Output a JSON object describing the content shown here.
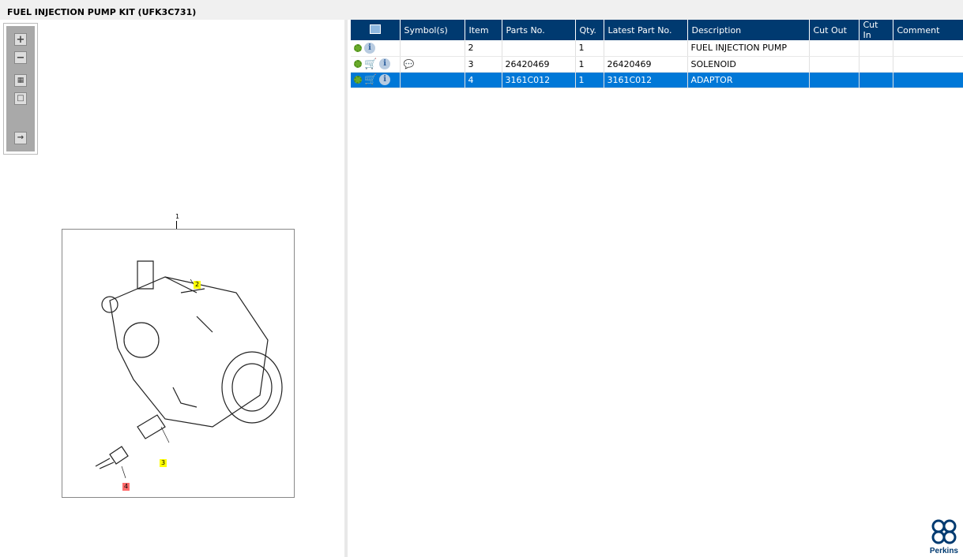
{
  "title": "FUEL INJECTION PUMP KIT (UFK3C731)",
  "toolbox": {
    "zoom_in": "zoom-in",
    "zoom_out": "zoom-out",
    "fit_all": "fit",
    "fit_frame": "frame",
    "export": "export"
  },
  "diagram": {
    "callouts": {
      "kit": "1",
      "pump": "2",
      "solenoid": "3",
      "adaptor": "4"
    },
    "colors": {
      "highlight": "#ffff00",
      "selected": "#ff6b6b"
    }
  },
  "table": {
    "headers": [
      "",
      "Symbol(s)",
      "Item",
      "Parts No.",
      "Qty.",
      "Latest Part No.",
      "Description",
      "Cut Out",
      "Cut In",
      "Comment"
    ],
    "rows": [
      {
        "icons": [
          "gear",
          "info"
        ],
        "symbol": "",
        "item": "2",
        "parts_no": "",
        "qty": "1",
        "latest": "",
        "description": "FUEL INJECTION PUMP",
        "cut_out": "",
        "cut_in": "",
        "comment": ""
      },
      {
        "icons": [
          "gear",
          "cart",
          "info"
        ],
        "symbol": "💬",
        "item": "3",
        "parts_no": "26420469",
        "qty": "1",
        "latest": "26420469",
        "description": "SOLENOID",
        "cut_out": "",
        "cut_in": "",
        "comment": ""
      },
      {
        "icons": [
          "gear",
          "cart",
          "info"
        ],
        "symbol": "",
        "item": "4",
        "parts_no": "3161C012",
        "qty": "1",
        "latest": "3161C012",
        "description": "ADAPTOR",
        "cut_out": "",
        "cut_in": "",
        "comment": "",
        "selected": true
      }
    ]
  },
  "logo": "Perkins",
  "colors": {
    "header": "#003a70",
    "selected": "#0078d7"
  }
}
